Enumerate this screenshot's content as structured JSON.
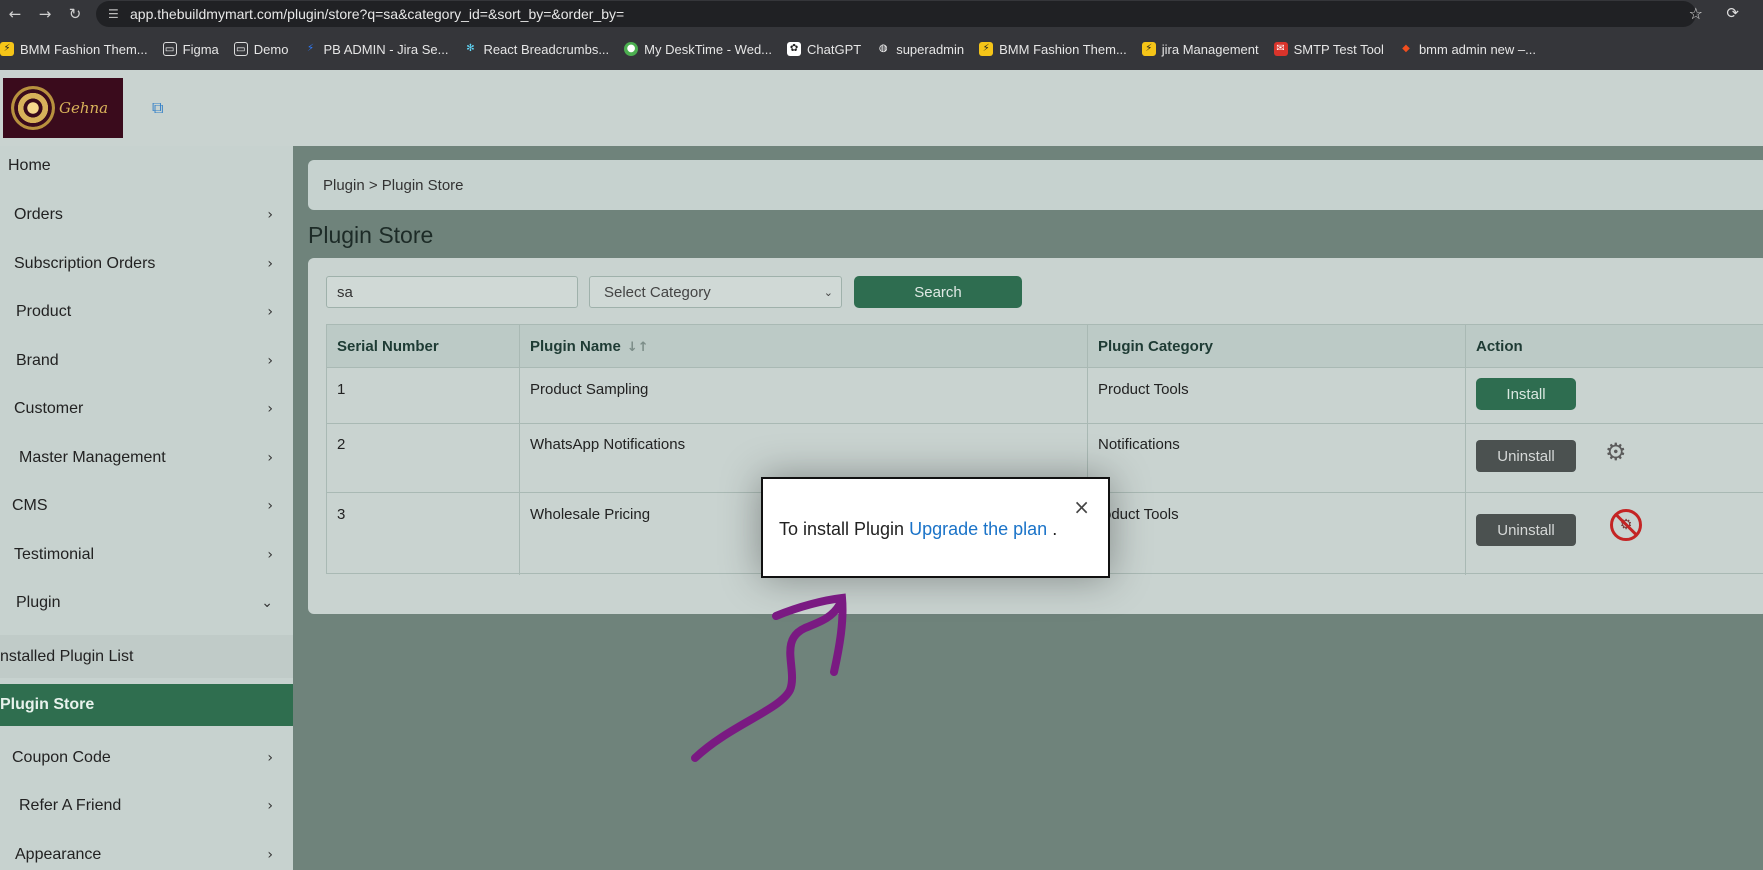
{
  "browser": {
    "url": "app.thebuildmymart.com/plugin/store?q=sa&category_id=&sort_by=&order_by=",
    "bookmarks": [
      {
        "label": "BMM Fashion Them...",
        "icon": "bolt-icon",
        "color": "#f5c518"
      },
      {
        "label": "Figma",
        "icon": "folder-icon",
        "color": "#35363a"
      },
      {
        "label": "Demo",
        "icon": "folder-icon",
        "color": "#35363a"
      },
      {
        "label": "PB ADMIN  - Jira Se...",
        "icon": "jira-icon",
        "color": "#2d7cff"
      },
      {
        "label": "React Breadcrumbs...",
        "icon": "react-icon",
        "color": "#35363a"
      },
      {
        "label": "My DeskTime - Wed...",
        "icon": "desktime-icon",
        "color": "#4caf50"
      },
      {
        "label": "ChatGPT",
        "icon": "chatgpt-icon",
        "color": "#ffffff"
      },
      {
        "label": "superadmin",
        "icon": "globe-icon",
        "color": "#35363a"
      },
      {
        "label": "BMM Fashion Them...",
        "icon": "bolt-icon",
        "color": "#f5c518"
      },
      {
        "label": "jira Management",
        "icon": "bolt-icon",
        "color": "#f5c518"
      },
      {
        "label": "SMTP Test Tool",
        "icon": "smtp-icon",
        "color": "#d9342b"
      },
      {
        "label": "bmm admin new –...",
        "icon": "figma-icon",
        "color": "#f24e1e"
      }
    ]
  },
  "header": {
    "logo_text": "Gehna"
  },
  "sidebar": {
    "items": [
      {
        "label": "Home",
        "chevron": ""
      },
      {
        "label": "Orders",
        "chevron": "›"
      },
      {
        "label": "Subscription Orders",
        "chevron": "›"
      },
      {
        "label": "Product",
        "chevron": "›"
      },
      {
        "label": "Brand",
        "chevron": "›"
      },
      {
        "label": "Customer",
        "chevron": "›"
      },
      {
        "label": "Master Management",
        "chevron": "›"
      },
      {
        "label": "CMS",
        "chevron": "›"
      },
      {
        "label": "Testimonial",
        "chevron": "›"
      },
      {
        "label": "Plugin",
        "chevron": "⌄"
      },
      {
        "label": "nstalled Plugin List",
        "chevron": ""
      },
      {
        "label": "Plugin Store",
        "chevron": ""
      },
      {
        "label": "Coupon Code",
        "chevron": "›"
      },
      {
        "label": "Refer A Friend",
        "chevron": "›"
      },
      {
        "label": "Appearance",
        "chevron": "›"
      }
    ]
  },
  "main": {
    "breadcrumb": "Plugin > Plugin Store",
    "title": "Plugin Store",
    "search": {
      "value": "sa"
    },
    "category": {
      "selected": "Select Category"
    },
    "search_button": "Search",
    "table": {
      "headers": [
        "Serial Number",
        "Plugin Name",
        "Plugin Category",
        "Action"
      ],
      "rows": [
        {
          "serial": "1",
          "name": "Product Sampling",
          "category": "Product Tools",
          "action": "Install"
        },
        {
          "serial": "2",
          "name": "WhatsApp Notifications",
          "category": "Notifications",
          "action": "Uninstall"
        },
        {
          "serial": "3",
          "name": "Wholesale Pricing",
          "category": "roduct Tools",
          "action": "Uninstall"
        }
      ]
    }
  },
  "modal": {
    "text": "To install Plugin",
    "link": "Upgrade the plan",
    "suffix": ".",
    "close": "×"
  },
  "colors": {
    "accent_green": "#2e6d50",
    "annotation_purple": "#7a1a82"
  }
}
